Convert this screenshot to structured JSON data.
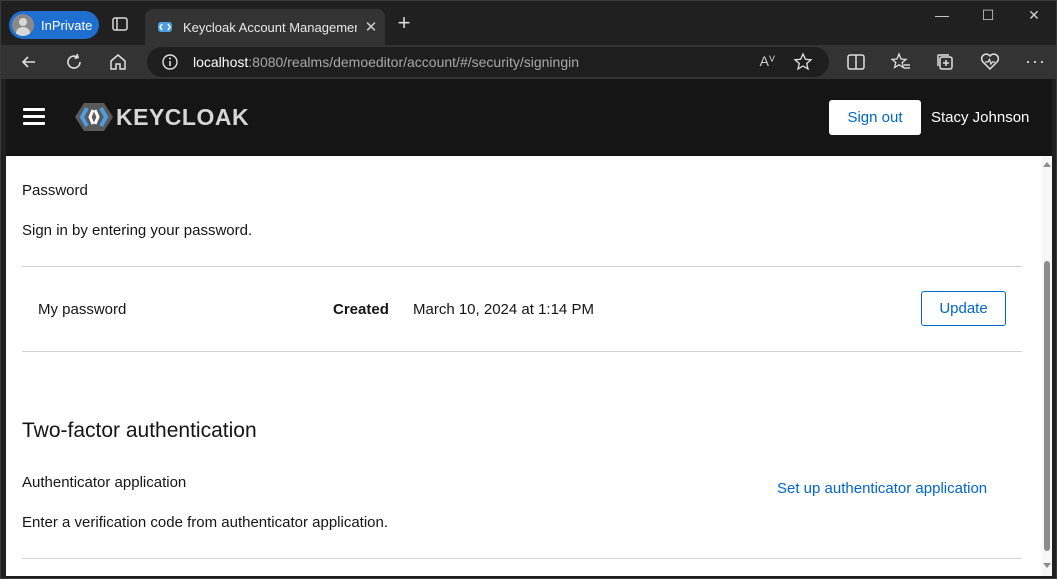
{
  "browser": {
    "inprivate_label": "InPrivate",
    "tab_title": "Keycloak Account Management",
    "tab_close": "✕",
    "new_tab": "+",
    "minimize": "—",
    "maximize": "☐",
    "close": "✕",
    "url_host": "localhost",
    "url_rest": ":8080/realms/demoeditor/account/#/security/signingin",
    "read_aloud": "Aⱽ",
    "accent": "#1f6fd1"
  },
  "header": {
    "logo_text": "KEYCLOAK",
    "signout_label": "Sign out",
    "username": "Stacy Johnson"
  },
  "password_section": {
    "title": "Password",
    "description": "Sign in by entering your password.",
    "row_label": "My password",
    "created_label": "Created",
    "created_value": "March 10, 2024 at 1:14 PM",
    "update_label": "Update"
  },
  "twofactor_section": {
    "title": "Two-factor authentication",
    "authapp_title": "Authenticator application",
    "setup_link": "Set up authenticator application",
    "authapp_description": "Enter a verification code from authenticator application."
  },
  "colors": {
    "link": "#0066cc",
    "masthead": "#151515"
  }
}
